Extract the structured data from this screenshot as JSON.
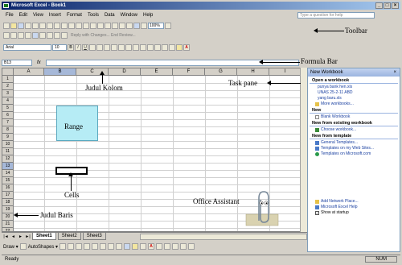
{
  "window": {
    "title": "Microsoft Excel - Book1",
    "controls": [
      "_",
      "□",
      "×"
    ]
  },
  "menu": {
    "items": [
      "File",
      "Edit",
      "View",
      "Insert",
      "Format",
      "Tools",
      "Data",
      "Window",
      "Help"
    ],
    "help_placeholder": "Type a question for help"
  },
  "toolbar": {
    "zoom": "100%",
    "font_name": "Arial",
    "font_size": "10",
    "reply_text": "Reply with Changes...  End Review..."
  },
  "formula_bar": {
    "name_box": "B13",
    "fx": "fx"
  },
  "grid": {
    "columns": [
      "A",
      "B",
      "C",
      "D",
      "E",
      "F",
      "G",
      "H",
      "I"
    ],
    "rows": [
      "1",
      "2",
      "3",
      "4",
      "5",
      "6",
      "7",
      "8",
      "9",
      "10",
      "11",
      "12",
      "13",
      "14",
      "15",
      "16",
      "17",
      "18",
      "19",
      "20",
      "21",
      "22"
    ]
  },
  "sheets": {
    "tabs": [
      "Sheet1",
      "Sheet2",
      "Sheet3"
    ],
    "nav": [
      "|◄",
      "◄",
      "►",
      "►|"
    ]
  },
  "drawing": {
    "draw_label": "Draw ▾",
    "autoshapes_label": "AutoShapes ▾"
  },
  "status": {
    "ready": "Ready",
    "num": "NUM"
  },
  "task_pane": {
    "title": "New Workbook",
    "open_section": "Open a workbook",
    "recent_files": [
      "punya bank hen.xls",
      "UNAS 25-2-11 ABD",
      "yang baru.xls"
    ],
    "more": "More workbooks...",
    "new_section": "New",
    "blank": "Blank Workbook",
    "existing_section": "New from existing workbook",
    "choose": "Choose workbook...",
    "template_section": "New from template",
    "templates": [
      "General Templates...",
      "Templates on my Web Sites...",
      "Templates on Microsoft.com"
    ],
    "footer_links": [
      "Add Network Place...",
      "Microsoft Excel Help"
    ],
    "show_startup": "Show at startup"
  },
  "annotations": {
    "toolbar": "Toolbar",
    "formula_bar": "Formula Bar",
    "judul_kolom": "Judul Kolom",
    "task_pane": "Task pane",
    "range": "Range",
    "cells": "Cells",
    "office_assistant": "Office Assistant",
    "judul_baris": "Judul Baris"
  },
  "colors": {
    "range_fill": "#b6ecf5",
    "title_bar": "#0a246a",
    "task_pane_header": "#9bb4e0"
  }
}
